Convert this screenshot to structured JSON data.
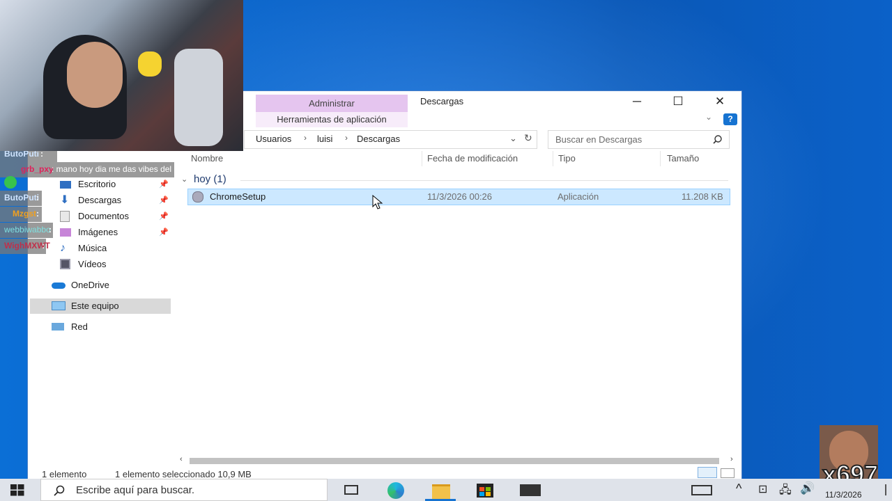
{
  "window": {
    "title": "Descargas",
    "ribbon_context_tab": "Administrar",
    "ribbon_context_group": "Herramientas de aplicación",
    "minimize": "─",
    "maximize": "☐",
    "close": "✕",
    "help": "?"
  },
  "address": {
    "crumbs": [
      "Usuarios",
      "luisi",
      "Descargas"
    ],
    "search_placeholder": "Buscar en Descargas"
  },
  "nav": {
    "items": [
      {
        "label": "Escritorio",
        "pinned": true
      },
      {
        "label": "Descargas",
        "pinned": true
      },
      {
        "label": "Documentos",
        "pinned": true
      },
      {
        "label": "Imágenes",
        "pinned": true
      },
      {
        "label": "Música",
        "pinned": false
      },
      {
        "label": "Vídeos",
        "pinned": false
      },
      {
        "label": "OneDrive",
        "pinned": false
      },
      {
        "label": "Este equipo",
        "pinned": false
      },
      {
        "label": "Red",
        "pinned": false
      }
    ]
  },
  "columns": [
    "Nombre",
    "Fecha de modificación",
    "Tipo",
    "Tamaño"
  ],
  "group": "hoy (1)",
  "files": [
    {
      "name": "ChromeSetup",
      "date": "11/3/2026 00:26",
      "type": "Aplicación",
      "size": "11.208 KB"
    }
  ],
  "status": {
    "count": "1 elemento",
    "selected": "1 elemento seleccionado  10,9 MB"
  },
  "chat": [
    {
      "user": "ButoPuti",
      "msg": ":"
    },
    {
      "user": "grb_pxy",
      "msg": ": mano hoy dia me das vibes del"
    },
    {
      "user": "ButoPuti",
      "msg": ":"
    },
    {
      "user": "Mzgst",
      "msg": ":"
    },
    {
      "user": "webbiwabbo",
      "msg": ":"
    },
    {
      "user": "WighMXWT",
      "msg": ":"
    }
  ],
  "taskbar": {
    "search_placeholder": "Escribe aquí para buscar.",
    "date": "11/3/2026"
  },
  "overlay": {
    "emote_text": "x697"
  },
  "colors": {
    "accent": "#1673d1",
    "selection": "#cce8ff",
    "ribbon_context": "#e5c5ef"
  }
}
